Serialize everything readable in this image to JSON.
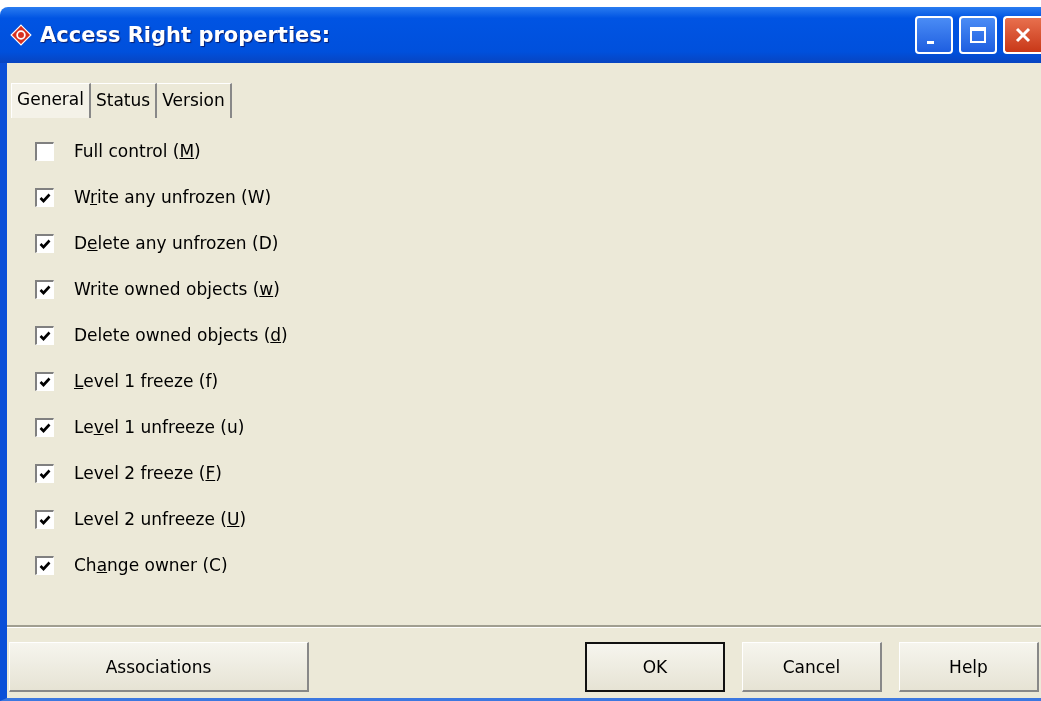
{
  "window": {
    "title": "Access Right properties:"
  },
  "tabs": [
    {
      "label": "General",
      "selected": true
    },
    {
      "label": "Status",
      "selected": false
    },
    {
      "label": "Version",
      "selected": false
    }
  ],
  "options": [
    {
      "before": "Full control (",
      "key": "M",
      "after": ")",
      "checked": false
    },
    {
      "before": "W",
      "key": "r",
      "after": "ite any unfrozen (W)",
      "checked": true
    },
    {
      "before": "D",
      "key": "e",
      "after": "lete any unfrozen (D)",
      "checked": true
    },
    {
      "before": "Write owned objects (",
      "key": "w",
      "after": ")",
      "checked": true
    },
    {
      "before": "Delete owned objects (",
      "key": "d",
      "after": ")",
      "checked": true
    },
    {
      "key": "L",
      "after": "evel 1 freeze (f)",
      "checked": true
    },
    {
      "before": "Le",
      "key": "v",
      "after": "el 1 unfreeze (u)",
      "checked": true
    },
    {
      "before": "Level 2 freeze (",
      "key": "F",
      "after": ")",
      "checked": true
    },
    {
      "before": "Level 2 unfreeze (",
      "key": "U",
      "after": ")",
      "checked": true
    },
    {
      "before": "Ch",
      "key": "a",
      "after": "nge owner (C)",
      "checked": true
    }
  ],
  "left_buttons": [
    {
      "label": "Associations",
      "default": false
    }
  ],
  "right_buttons": [
    {
      "label": "OK",
      "default": true
    },
    {
      "label": "Cancel",
      "default": false
    },
    {
      "label": "Help",
      "default": false
    }
  ]
}
